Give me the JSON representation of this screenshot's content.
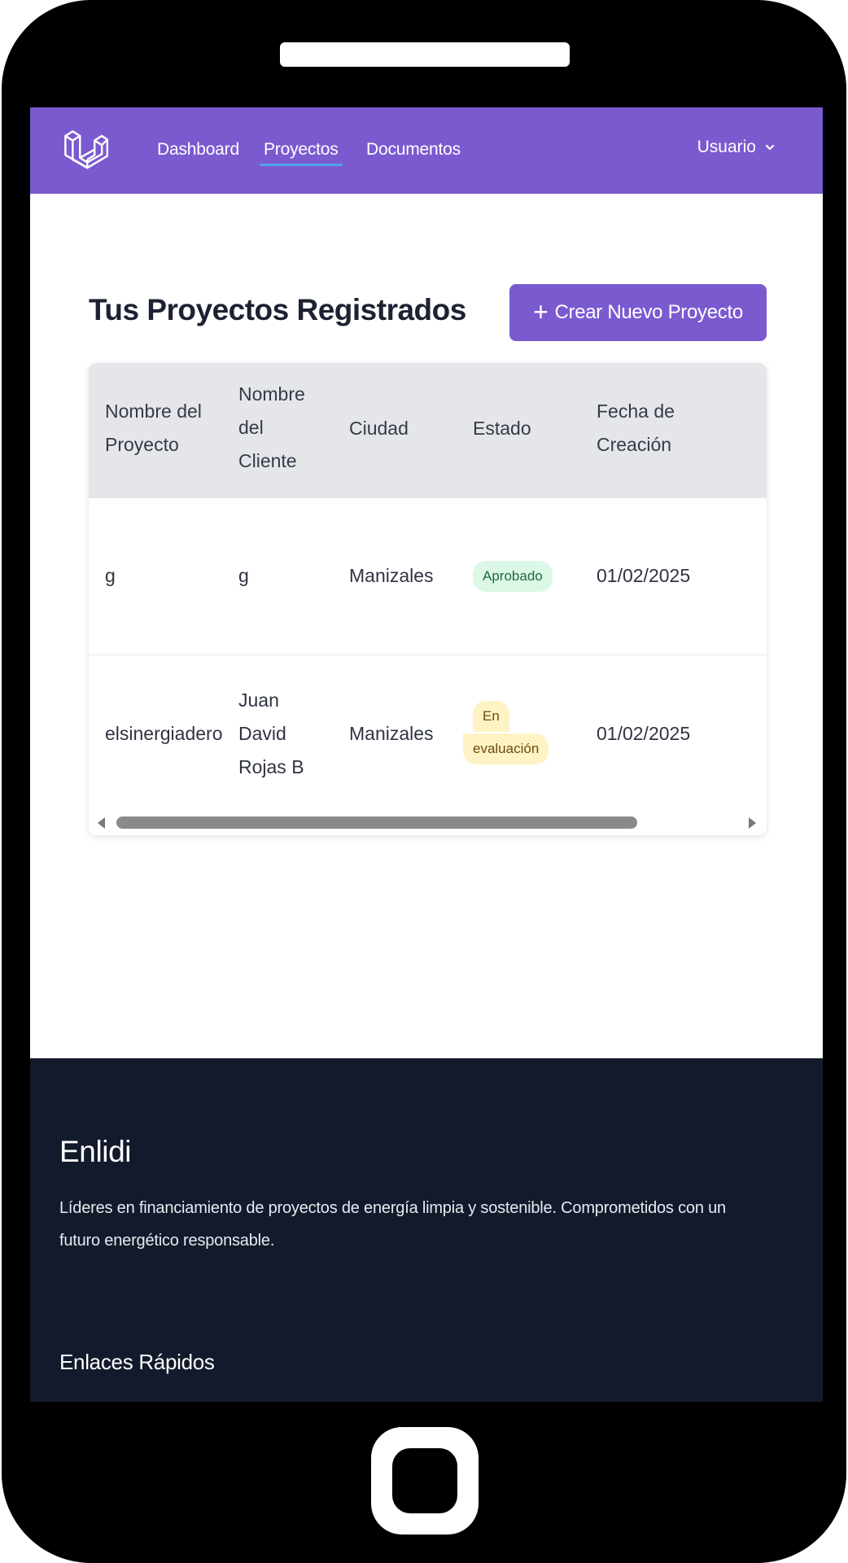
{
  "navbar": {
    "logo_icon": "laravel-logo-icon",
    "links": [
      {
        "label": "Dashboard",
        "active": false
      },
      {
        "label": "Proyectos",
        "active": true
      },
      {
        "label": "Documentos",
        "active": false
      }
    ],
    "user_label": "Usuario",
    "user_icon": "chevron-down-icon"
  },
  "main": {
    "title": "Tus Proyectos Registrados",
    "create_button": {
      "icon": "plus-icon",
      "label": "Crear Nuevo Proyecto"
    }
  },
  "table": {
    "headers": {
      "project_name": [
        "Nombre del",
        "Proyecto"
      ],
      "client_name": [
        "Nombre",
        "del",
        "Cliente"
      ],
      "city": "Ciudad",
      "status": "Estado",
      "created": [
        "Fecha de",
        "Creación"
      ]
    },
    "rows": [
      {
        "project_name": "g",
        "client_name": [
          "g"
        ],
        "city": "Manizales",
        "status": [
          "Aprobado"
        ],
        "created": "01/02/2025"
      },
      {
        "project_name": "elsinergiadero",
        "client_name": [
          "Juan",
          "David",
          "Rojas B"
        ],
        "city": "Manizales",
        "status": [
          "En",
          "evaluación"
        ],
        "created": "01/02/2025"
      }
    ]
  },
  "footer": {
    "brand": "Enlidi",
    "description": [
      "Líderes en financiamiento de proyectos de energía limpia y sostenible. Comprometidos con un",
      "futuro energético responsable."
    ],
    "quick_links_title": "Enlaces Rápidos"
  },
  "colors": {
    "brand_purple": "#7b5ad0",
    "footer_bg": "#131a2b",
    "approved_bg": "#dcf7e6",
    "evaluation_bg": "#fdf3c4"
  }
}
